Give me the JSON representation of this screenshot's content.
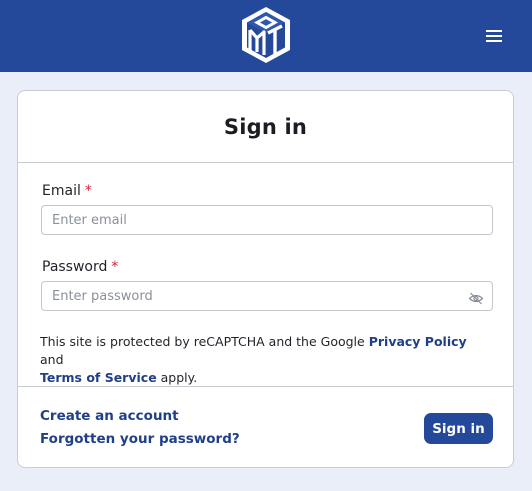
{
  "header": {
    "logo_icon": "mtg-hexagon-logo-icon",
    "menu_icon": "hamburger-menu-icon",
    "background_color": "#25499a"
  },
  "card": {
    "title": "Sign in",
    "email": {
      "label": "Email",
      "required_marker": "*",
      "placeholder": "Enter email",
      "value": ""
    },
    "password": {
      "label": "Password",
      "required_marker": "*",
      "placeholder": "Enter password",
      "value": "",
      "toggle_icon": "eye-slash-icon"
    },
    "recaptcha_notice": {
      "prefix": "This site is protected by reCAPTCHA and the Google ",
      "privacy_link": "Privacy Policy",
      "middle": " and",
      "terms_link": "Terms of Service",
      "suffix": " apply."
    },
    "footer": {
      "create_account": "Create an account",
      "forgot_password": "Forgotten your password?",
      "submit_label": "Sign in"
    }
  },
  "colors": {
    "accent": "#25499a",
    "link": "#1f3f87",
    "required": "#d0253b",
    "page_background": "#e9eef8"
  }
}
